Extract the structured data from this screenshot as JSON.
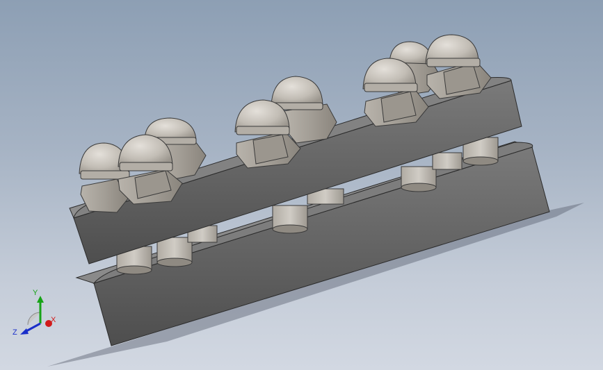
{
  "viewport": {
    "background_top": "#8d9fb4",
    "background_bottom": "#d2d8e2",
    "model": {
      "description_icon": "cad-assembly",
      "plate_color": "#6e6e6e",
      "nut_color": "#a8a29a",
      "cap_color": "#cbc6bf"
    }
  },
  "triad": {
    "x_label": "X",
    "y_label": "Y",
    "z_label": "Z",
    "x_color": "#d11a1a",
    "y_color": "#17a317",
    "z_color": "#1a2fc9"
  }
}
